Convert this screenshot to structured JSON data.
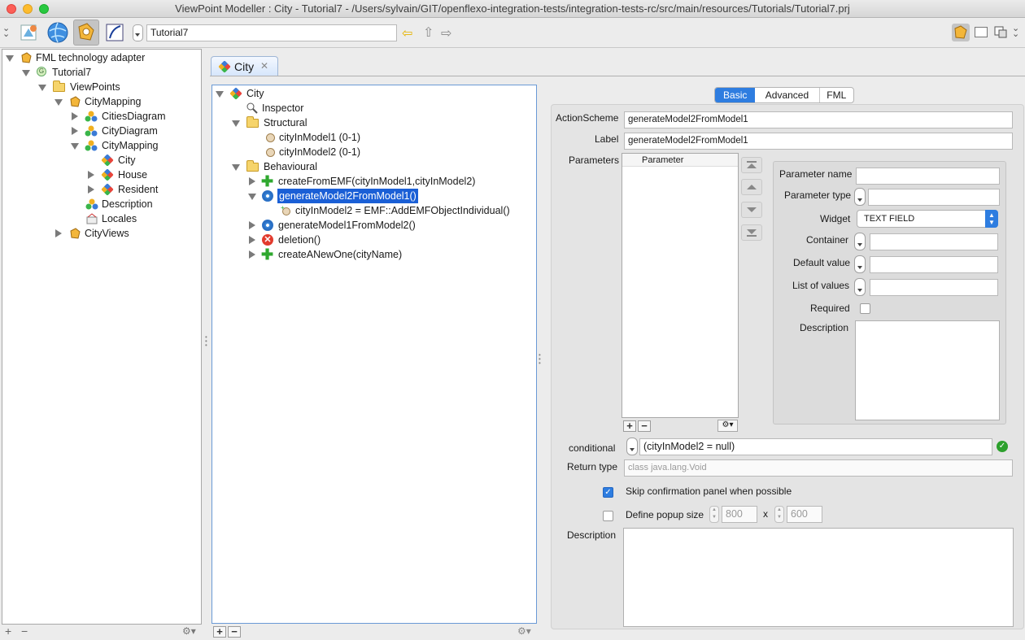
{
  "window": {
    "title": "ViewPoint Modeller : City - Tutorial7 - /Users/sylvain/GIT/openflexo-integration-tests/integration-tests-rc/src/main/resources/Tutorials/Tutorial7.prj"
  },
  "toolbar": {
    "project_field": "Tutorial7"
  },
  "left_tree": [
    {
      "label": "FML technology adapter"
    },
    {
      "label": "Tutorial7"
    },
    {
      "label": "ViewPoints"
    },
    {
      "label": "CityMapping"
    },
    {
      "label": "CitiesDiagram"
    },
    {
      "label": "CityDiagram"
    },
    {
      "label": "CityMapping"
    },
    {
      "label": "City"
    },
    {
      "label": "House"
    },
    {
      "label": "Resident"
    },
    {
      "label": "Description"
    },
    {
      "label": "Locales"
    },
    {
      "label": "CityViews"
    }
  ],
  "editor_tab": {
    "label": "City",
    "close": "✕"
  },
  "center_tree": [
    {
      "label": "City"
    },
    {
      "label": "Inspector"
    },
    {
      "label": "Structural"
    },
    {
      "label": "cityInModel1 (0-1)"
    },
    {
      "label": "cityInModel2 (0-1)"
    },
    {
      "label": "Behavioural"
    },
    {
      "label": "createFromEMF(cityInModel1,cityInModel2)"
    },
    {
      "label": "generateModel2FromModel1()"
    },
    {
      "label": "cityInModel2 = EMF::AddEMFObjectIndividual()"
    },
    {
      "label": "generateModel1FromModel2()"
    },
    {
      "label": "deletion()"
    },
    {
      "label": "createANewOne(cityName)"
    }
  ],
  "tabs": {
    "basic": "Basic",
    "advanced": "Advanced",
    "fml": "FML"
  },
  "form": {
    "action_scheme_label": "ActionScheme",
    "action_scheme_value": "generateModel2FromModel1",
    "label_label": "Label",
    "label_value": "generateModel2FromModel1",
    "parameters_label": "Parameters",
    "parameter_col": "Parameter",
    "param_name_label": "Parameter name",
    "param_type_label": "Parameter type",
    "widget_label": "Widget",
    "widget_value": "TEXT FIELD",
    "container_label": "Container",
    "default_value_label": "Default value",
    "list_values_label": "List of values",
    "required_label": "Required",
    "param_description_label": "Description",
    "conditional_label": "conditional",
    "conditional_value": "(cityInModel2 = null)",
    "return_type_label": "Return type",
    "return_type_value": "class java.lang.Void",
    "skip_label": "Skip confirmation panel when possible",
    "popup_label": "Define popup size",
    "popup_w": "800",
    "popup_x": "x",
    "popup_h": "600",
    "description_label": "Description"
  },
  "icons": [
    "collapse-icon",
    "viewpoint-icon",
    "globe-icon",
    "fml-icon",
    "edit-icon",
    "back-arrow-icon",
    "up-arrow-icon",
    "forward-arrow-icon",
    "gear-icon"
  ],
  "colors": {
    "selection": "#1a5fd6",
    "tab_active": "#2e7de0",
    "valid": "#2ca02c"
  }
}
